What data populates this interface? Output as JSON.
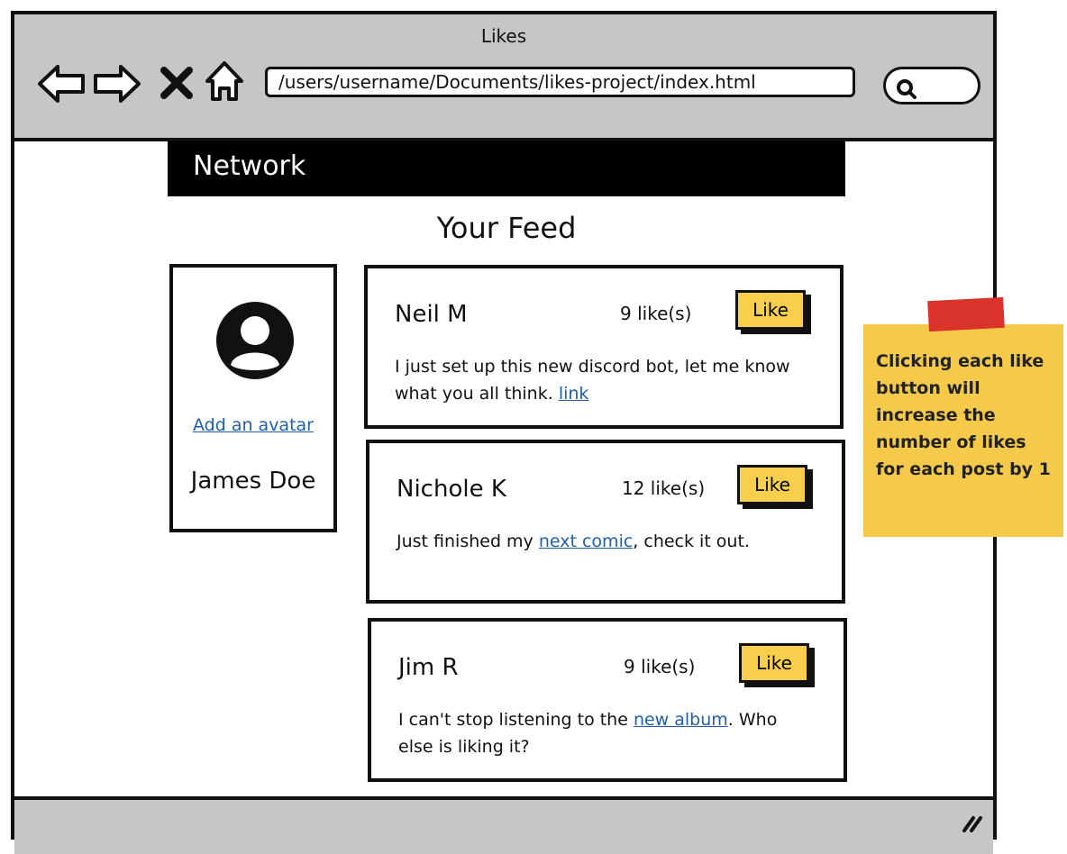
{
  "window": {
    "title": "Likes"
  },
  "browser": {
    "url": "/users/username/Documents/likes-project/index.html"
  },
  "app": {
    "brand": "Network",
    "feed_title": "Your Feed"
  },
  "profile": {
    "add_avatar_label": "Add an avatar",
    "name": "James Doe"
  },
  "posts": [
    {
      "author": "Neil M",
      "likes": "9 like(s)",
      "like_label": "Like",
      "text_before": "I just set up this new discord bot, let me know what you all think. ",
      "link_text": "link",
      "text_after": ""
    },
    {
      "author": "Nichole K",
      "likes": "12 like(s)",
      "like_label": "Like",
      "text_before": "Just finished my ",
      "link_text": "next comic",
      "text_after": ", check it out."
    },
    {
      "author": "Jim R",
      "likes": "9 like(s)",
      "like_label": "Like",
      "text_before": "I can't stop listening to the ",
      "link_text": "new album",
      "text_after": ". Who else is liking it?"
    }
  ],
  "note": {
    "text": "Clicking each like button will increase the number of likes for each post by 1"
  },
  "colors": {
    "like_button": "#f7cf4d",
    "note": "#f5c94a",
    "tape": "#d9332b",
    "link": "#1f5fa8",
    "chrome": "#c6c6c6"
  },
  "icons": [
    "back-arrow-icon",
    "forward-arrow-icon",
    "stop-icon",
    "home-icon",
    "search-icon",
    "user-avatar-icon",
    "resize-grip-icon"
  ]
}
